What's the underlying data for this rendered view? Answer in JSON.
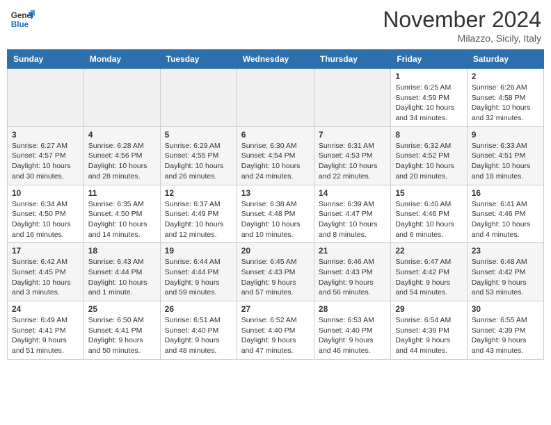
{
  "header": {
    "logo_line1": "General",
    "logo_line2": "Blue",
    "month_title": "November 2024",
    "location": "Milazzo, Sicily, Italy"
  },
  "weekdays": [
    "Sunday",
    "Monday",
    "Tuesday",
    "Wednesday",
    "Thursday",
    "Friday",
    "Saturday"
  ],
  "weeks": [
    [
      {
        "day": "",
        "info": ""
      },
      {
        "day": "",
        "info": ""
      },
      {
        "day": "",
        "info": ""
      },
      {
        "day": "",
        "info": ""
      },
      {
        "day": "",
        "info": ""
      },
      {
        "day": "1",
        "info": "Sunrise: 6:25 AM\nSunset: 4:59 PM\nDaylight: 10 hours\nand 34 minutes."
      },
      {
        "day": "2",
        "info": "Sunrise: 6:26 AM\nSunset: 4:58 PM\nDaylight: 10 hours\nand 32 minutes."
      }
    ],
    [
      {
        "day": "3",
        "info": "Sunrise: 6:27 AM\nSunset: 4:57 PM\nDaylight: 10 hours\nand 30 minutes."
      },
      {
        "day": "4",
        "info": "Sunrise: 6:28 AM\nSunset: 4:56 PM\nDaylight: 10 hours\nand 28 minutes."
      },
      {
        "day": "5",
        "info": "Sunrise: 6:29 AM\nSunset: 4:55 PM\nDaylight: 10 hours\nand 26 minutes."
      },
      {
        "day": "6",
        "info": "Sunrise: 6:30 AM\nSunset: 4:54 PM\nDaylight: 10 hours\nand 24 minutes."
      },
      {
        "day": "7",
        "info": "Sunrise: 6:31 AM\nSunset: 4:53 PM\nDaylight: 10 hours\nand 22 minutes."
      },
      {
        "day": "8",
        "info": "Sunrise: 6:32 AM\nSunset: 4:52 PM\nDaylight: 10 hours\nand 20 minutes."
      },
      {
        "day": "9",
        "info": "Sunrise: 6:33 AM\nSunset: 4:51 PM\nDaylight: 10 hours\nand 18 minutes."
      }
    ],
    [
      {
        "day": "10",
        "info": "Sunrise: 6:34 AM\nSunset: 4:50 PM\nDaylight: 10 hours\nand 16 minutes."
      },
      {
        "day": "11",
        "info": "Sunrise: 6:35 AM\nSunset: 4:50 PM\nDaylight: 10 hours\nand 14 minutes."
      },
      {
        "day": "12",
        "info": "Sunrise: 6:37 AM\nSunset: 4:49 PM\nDaylight: 10 hours\nand 12 minutes."
      },
      {
        "day": "13",
        "info": "Sunrise: 6:38 AM\nSunset: 4:48 PM\nDaylight: 10 hours\nand 10 minutes."
      },
      {
        "day": "14",
        "info": "Sunrise: 6:39 AM\nSunset: 4:47 PM\nDaylight: 10 hours\nand 8 minutes."
      },
      {
        "day": "15",
        "info": "Sunrise: 6:40 AM\nSunset: 4:46 PM\nDaylight: 10 hours\nand 6 minutes."
      },
      {
        "day": "16",
        "info": "Sunrise: 6:41 AM\nSunset: 4:46 PM\nDaylight: 10 hours\nand 4 minutes."
      }
    ],
    [
      {
        "day": "17",
        "info": "Sunrise: 6:42 AM\nSunset: 4:45 PM\nDaylight: 10 hours\nand 3 minutes."
      },
      {
        "day": "18",
        "info": "Sunrise: 6:43 AM\nSunset: 4:44 PM\nDaylight: 10 hours\nand 1 minute."
      },
      {
        "day": "19",
        "info": "Sunrise: 6:44 AM\nSunset: 4:44 PM\nDaylight: 9 hours\nand 59 minutes."
      },
      {
        "day": "20",
        "info": "Sunrise: 6:45 AM\nSunset: 4:43 PM\nDaylight: 9 hours\nand 57 minutes."
      },
      {
        "day": "21",
        "info": "Sunrise: 6:46 AM\nSunset: 4:43 PM\nDaylight: 9 hours\nand 56 minutes."
      },
      {
        "day": "22",
        "info": "Sunrise: 6:47 AM\nSunset: 4:42 PM\nDaylight: 9 hours\nand 54 minutes."
      },
      {
        "day": "23",
        "info": "Sunrise: 6:48 AM\nSunset: 4:42 PM\nDaylight: 9 hours\nand 53 minutes."
      }
    ],
    [
      {
        "day": "24",
        "info": "Sunrise: 6:49 AM\nSunset: 4:41 PM\nDaylight: 9 hours\nand 51 minutes."
      },
      {
        "day": "25",
        "info": "Sunrise: 6:50 AM\nSunset: 4:41 PM\nDaylight: 9 hours\nand 50 minutes."
      },
      {
        "day": "26",
        "info": "Sunrise: 6:51 AM\nSunset: 4:40 PM\nDaylight: 9 hours\nand 48 minutes."
      },
      {
        "day": "27",
        "info": "Sunrise: 6:52 AM\nSunset: 4:40 PM\nDaylight: 9 hours\nand 47 minutes."
      },
      {
        "day": "28",
        "info": "Sunrise: 6:53 AM\nSunset: 4:40 PM\nDaylight: 9 hours\nand 46 minutes."
      },
      {
        "day": "29",
        "info": "Sunrise: 6:54 AM\nSunset: 4:39 PM\nDaylight: 9 hours\nand 44 minutes."
      },
      {
        "day": "30",
        "info": "Sunrise: 6:55 AM\nSunset: 4:39 PM\nDaylight: 9 hours\nand 43 minutes."
      }
    ]
  ]
}
